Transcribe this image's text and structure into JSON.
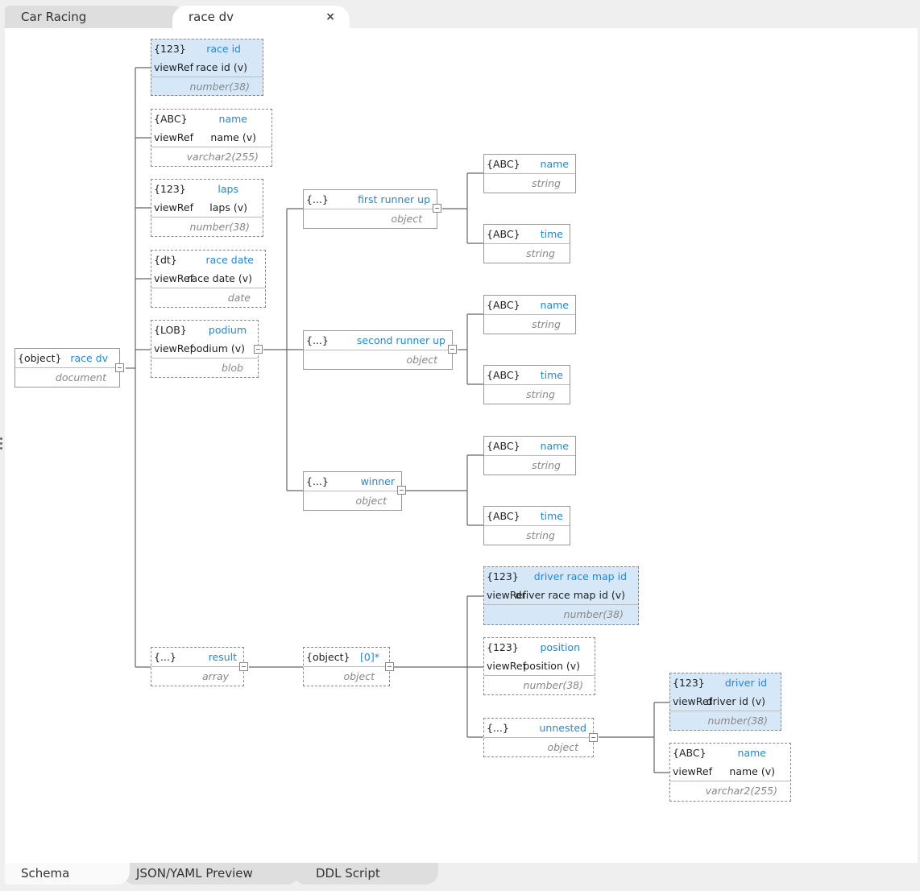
{
  "tabs": [
    {
      "label": "Car Racing",
      "active": false
    },
    {
      "label": "race dv",
      "active": true,
      "close_icon": "×"
    }
  ],
  "bottom_tabs": [
    {
      "label": "Schema",
      "active": true
    },
    {
      "label": "JSON/YAML Preview",
      "active": false
    },
    {
      "label": "DDL Script",
      "active": false
    }
  ],
  "colors": {
    "accent": "#1e88e5",
    "highlight": "#d6e8f8",
    "border": "#999999"
  },
  "nodes": {
    "root": {
      "kind": "{object}",
      "name": "race dv",
      "type": "document"
    },
    "race_id": {
      "kind": "{123}",
      "name": "race id",
      "ref_label": "viewRef",
      "ref": "race id (v)",
      "type": "number(38)"
    },
    "name": {
      "kind": "{ABC}",
      "name": "name",
      "ref_label": "viewRef",
      "ref": "name (v)",
      "type": "varchar2(255)"
    },
    "laps": {
      "kind": "{123}",
      "name": "laps",
      "ref_label": "viewRef",
      "ref": "laps (v)",
      "type": "number(38)"
    },
    "race_date": {
      "kind": "{dt}",
      "name": "race date",
      "ref_label": "viewRef",
      "ref": "race date (v)",
      "type": "date"
    },
    "podium": {
      "kind": "{LOB}",
      "name": "podium",
      "ref_label": "viewRef",
      "ref": "podium (v)",
      "type": "blob"
    },
    "first_runner_up": {
      "kind": "{...}",
      "name": "first runner up",
      "type": "object"
    },
    "fru_name": {
      "kind": "{ABC}",
      "name": "name",
      "type": "string"
    },
    "fru_time": {
      "kind": "{ABC}",
      "name": "time",
      "type": "string"
    },
    "second_runner_up": {
      "kind": "{...}",
      "name": "second runner up",
      "type": "object"
    },
    "sru_name": {
      "kind": "{ABC}",
      "name": "name",
      "type": "string"
    },
    "sru_time": {
      "kind": "{ABC}",
      "name": "time",
      "type": "string"
    },
    "winner": {
      "kind": "{...}",
      "name": "winner",
      "type": "object"
    },
    "w_name": {
      "kind": "{ABC}",
      "name": "name",
      "type": "string"
    },
    "w_time": {
      "kind": "{ABC}",
      "name": "time",
      "type": "string"
    },
    "result": {
      "kind": "{...}",
      "name": "result",
      "type": "array"
    },
    "item0": {
      "kind": "{object}",
      "name": "[0]*",
      "type": "object"
    },
    "driver_race_map_id": {
      "kind": "{123}",
      "name": "driver race map id",
      "ref_label": "viewRef",
      "ref": "driver race map id (v)",
      "type": "number(38)"
    },
    "position": {
      "kind": "{123}",
      "name": "position",
      "ref_label": "viewRef",
      "ref": "position (v)",
      "type": "number(38)"
    },
    "unnested": {
      "kind": "{...}",
      "name": "unnested",
      "type": "object"
    },
    "driver_id": {
      "kind": "{123}",
      "name": "driver id",
      "ref_label": "viewRef",
      "ref": "driver id (v)",
      "type": "number(38)"
    },
    "driver_name": {
      "kind": "{ABC}",
      "name": "name",
      "ref_label": "viewRef",
      "ref": "name (v)",
      "type": "varchar2(255)"
    }
  }
}
